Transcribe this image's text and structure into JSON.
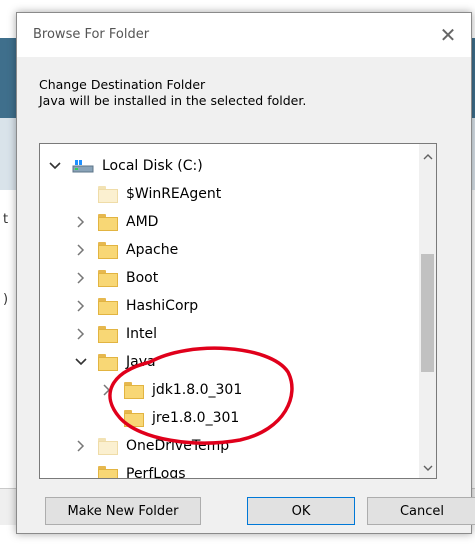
{
  "dialog": {
    "title": "Browse For Folder",
    "description_line1": "Change Destination Folder",
    "description_line2": "Java will be installed in the selected folder.",
    "buttons": {
      "make_new_folder": "Make New Folder",
      "ok": "OK",
      "cancel": "Cancel"
    }
  },
  "tree": {
    "root": "Local Disk (C:)",
    "items": [
      {
        "label": "$WinREAgent",
        "expander": "none",
        "pale": true
      },
      {
        "label": "AMD",
        "expander": "collapsed"
      },
      {
        "label": "Apache",
        "expander": "collapsed"
      },
      {
        "label": "Boot",
        "expander": "collapsed"
      },
      {
        "label": "HashiCorp",
        "expander": "collapsed"
      },
      {
        "label": "Intel",
        "expander": "collapsed"
      },
      {
        "label": "Java",
        "expander": "expanded"
      },
      {
        "label": "jdk1.8.0_301",
        "expander": "collapsed"
      },
      {
        "label": "jre1.8.0_301",
        "expander": "none",
        "selected": true
      },
      {
        "label": "OneDriveTemp",
        "expander": "collapsed",
        "pale": true
      },
      {
        "label": "PerfLogs",
        "expander": "none"
      }
    ]
  },
  "background": {
    "frag1": "t",
    "frag2": ")"
  },
  "colors": {
    "folder": "#f8d775",
    "selection": "#d9d9d9",
    "annotation": "#e0001b",
    "accent": "#0078d7"
  }
}
